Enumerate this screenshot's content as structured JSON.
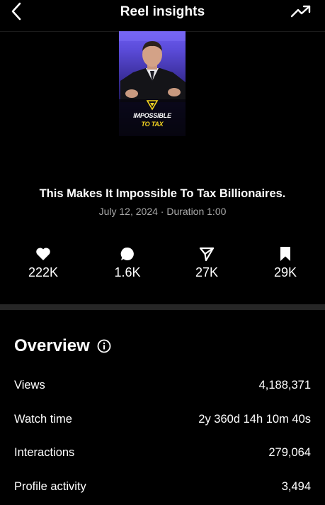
{
  "header": {
    "title": "Reel insights",
    "back_icon": "chevron-left-icon",
    "trend_icon": "trending-up-icon"
  },
  "reel": {
    "overlay_line1": "IMPOSSIBLE",
    "overlay_line2": "TO TAX",
    "title": "This Makes It Impossible To Tax Billionaires.",
    "meta": "July 12, 2024 · Duration 1:00"
  },
  "stats": [
    {
      "icon": "heart-icon",
      "value": "222K"
    },
    {
      "icon": "comment-icon",
      "value": "1.6K"
    },
    {
      "icon": "share-icon",
      "value": "27K"
    },
    {
      "icon": "bookmark-icon",
      "value": "29K"
    }
  ],
  "overview": {
    "title": "Overview",
    "info_icon": "info-icon",
    "rows": [
      {
        "label": "Views",
        "value": "4,188,371"
      },
      {
        "label": "Watch time",
        "value": "2y 360d 14h 10m 40s"
      },
      {
        "label": "Interactions",
        "value": "279,064"
      },
      {
        "label": "Profile activity",
        "value": "3,494"
      }
    ]
  },
  "colors": {
    "background": "#000000",
    "secondary_text": "#a8a8a8",
    "divider": "#262626",
    "overlay_accent": "#f3d320"
  }
}
